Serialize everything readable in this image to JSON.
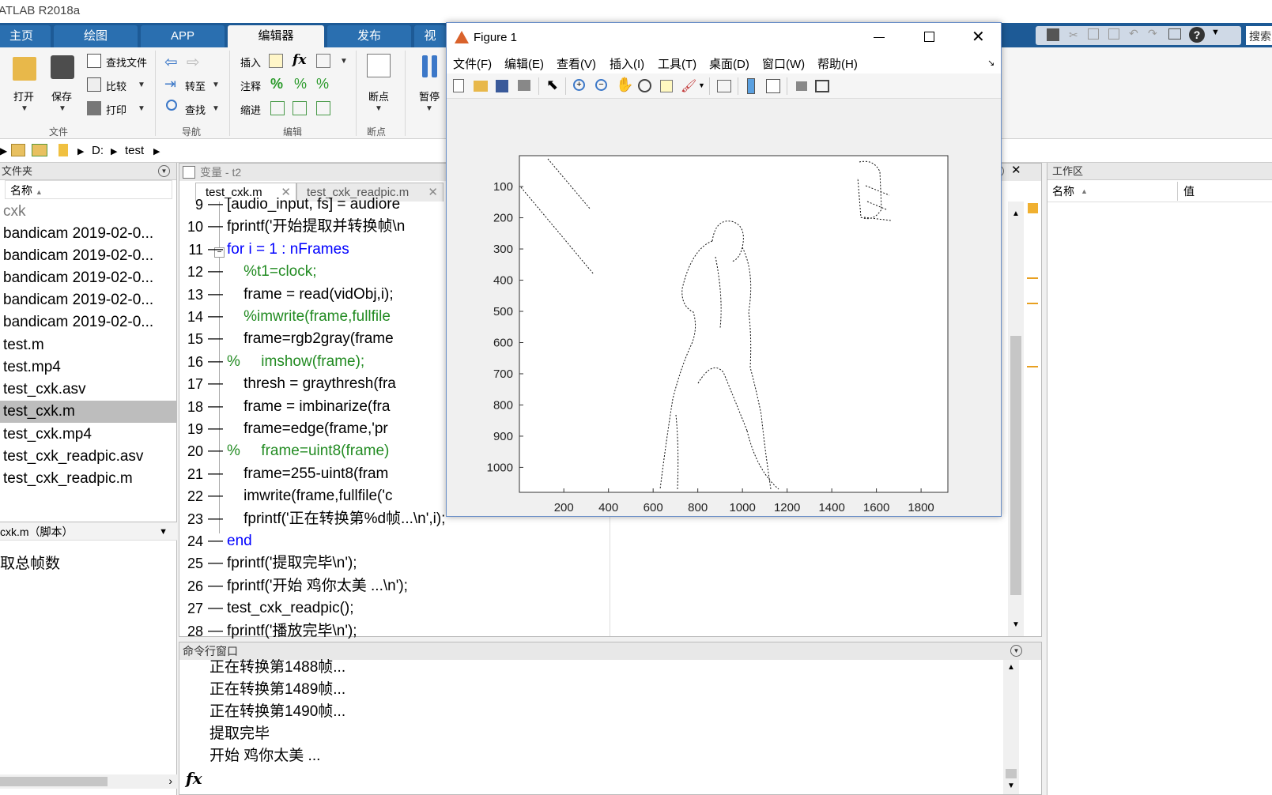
{
  "app": {
    "title": "ATLAB R2018a"
  },
  "tabs": [
    {
      "label": "主页"
    },
    {
      "label": "绘图"
    },
    {
      "label": "APP"
    },
    {
      "label": "编辑器"
    },
    {
      "label": "发布"
    },
    {
      "label": "视"
    }
  ],
  "quick_search": {
    "placeholder": "搜索"
  },
  "ribbon": {
    "file": {
      "open": "打开",
      "save": "保存",
      "find_files": "查找文件",
      "compare": "比较",
      "print": "打印",
      "group": "文件"
    },
    "nav": {
      "goto": "转至",
      "find": "查找",
      "group": "导航"
    },
    "edit": {
      "insert": "插入",
      "comment": "注释",
      "indent": "缩进",
      "fx": "fx",
      "group": "编辑"
    },
    "breakpoints": {
      "label": "断点",
      "group": "断点"
    },
    "run": {
      "pause": "暂停"
    }
  },
  "address": {
    "drive": "D:",
    "folder": "test"
  },
  "folder_panel": {
    "title": "文件夹",
    "column": "名称",
    "items": [
      "cxk",
      "bandicam 2019-02-0...",
      "bandicam 2019-02-0...",
      "bandicam 2019-02-0...",
      "bandicam 2019-02-0...",
      "bandicam 2019-02-0...",
      "test.m",
      "test.mp4",
      "test_cxk.asv",
      "test_cxk.m",
      "test_cxk.mp4",
      "test_cxk_readpic.asv",
      "test_cxk_readpic.m"
    ],
    "details_title": "cxk.m（脚本）",
    "details_text": "取总帧数"
  },
  "editor": {
    "variables_header": "变量 - t2",
    "tabs": [
      {
        "label": "test_cxk.m"
      },
      {
        "label": "test_cxk_readpic.m"
      }
    ],
    "lines": [
      {
        "n": "9",
        "text": "[audio_input, fs] = audiore"
      },
      {
        "n": "10",
        "text": "fprintf('开始提取并转换帧\\n"
      },
      {
        "n": "11",
        "text": "for i = 1 : nFrames"
      },
      {
        "n": "12",
        "text": "    %t1=clock;"
      },
      {
        "n": "13",
        "text": "    frame = read(vidObj,i);"
      },
      {
        "n": "14",
        "text": "    %imwrite(frame,fullfile"
      },
      {
        "n": "15",
        "text": "    frame=rgb2gray(frame"
      },
      {
        "n": "16",
        "text": "%     imshow(frame);"
      },
      {
        "n": "17",
        "text": "    thresh = graythresh(fra"
      },
      {
        "n": "18",
        "text": "    frame = imbinarize(fra"
      },
      {
        "n": "19",
        "text": "    frame=edge(frame,'pr"
      },
      {
        "n": "20",
        "text": "%     frame=uint8(frame)"
      },
      {
        "n": "21",
        "text": "    frame=255-uint8(fram"
      },
      {
        "n": "22",
        "text": "    imwrite(frame,fullfile('c"
      },
      {
        "n": "23",
        "text": "    fprintf('正在转换第%d帧...\\n',i);"
      },
      {
        "n": "24",
        "text": "end"
      },
      {
        "n": "25",
        "text": "fprintf('提取完毕\\n');"
      },
      {
        "n": "26",
        "text": "fprintf('开始 鸡你太美 ...\\n');"
      },
      {
        "n": "27",
        "text": "test_cxk_readpic();"
      },
      {
        "n": "28",
        "text": "fprintf('播放完毕\\n');"
      }
    ]
  },
  "workspace": {
    "title": "工作区",
    "col_name": "名称",
    "col_value": "值"
  },
  "command_window": {
    "title": "命令行窗口",
    "lines": [
      "正在转换第1488帧...",
      "正在转换第1489帧...",
      "正在转换第1490帧...",
      "提取完毕",
      "开始 鸡你太美 ..."
    ],
    "prompt": "fx"
  },
  "figure": {
    "title": "Figure 1",
    "menu": [
      "文件(F)",
      "编辑(E)",
      "查看(V)",
      "插入(I)",
      "工具(T)",
      "桌面(D)",
      "窗口(W)",
      "帮助(H)"
    ],
    "x_ticks": [
      "200",
      "400",
      "600",
      "800",
      "1000",
      "1200",
      "1400",
      "1600",
      "1800"
    ],
    "y_ticks": [
      "100",
      "200",
      "300",
      "400",
      "500",
      "600",
      "700",
      "800",
      "900",
      "1000"
    ],
    "xlim": [
      1,
      1920
    ],
    "ylim": [
      1,
      1080
    ]
  },
  "colors": {
    "tab_bar": "#1d5a96",
    "keyword": "#0000ff",
    "comment": "#228b22",
    "string": "#a020f0"
  }
}
